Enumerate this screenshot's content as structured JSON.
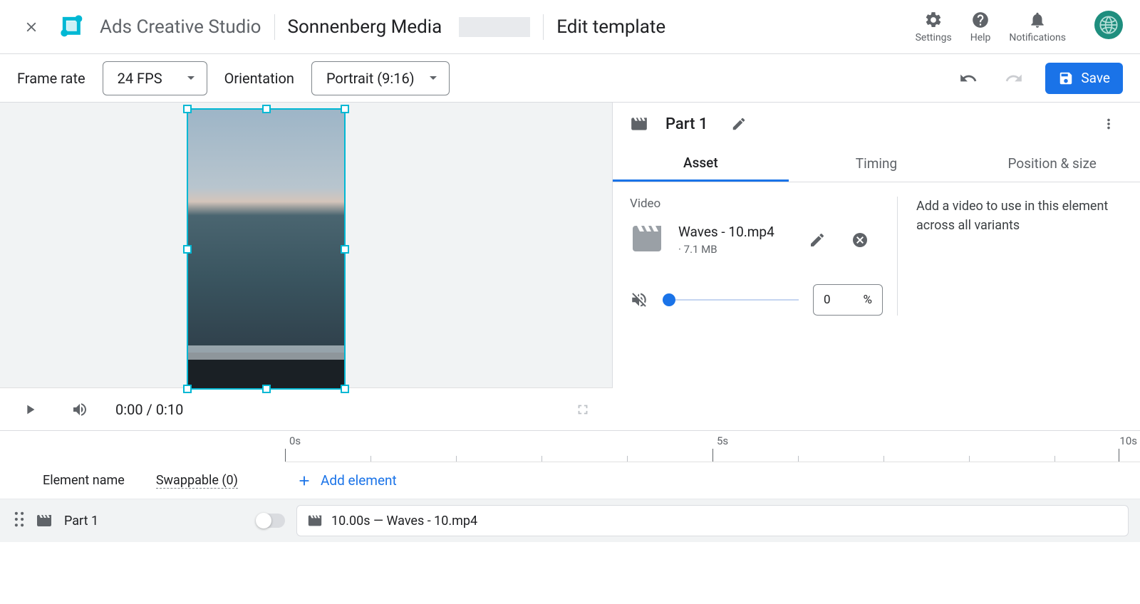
{
  "header": {
    "appTitle": "Ads Creative Studio",
    "workspace": "Sonnenberg Media",
    "breadcrumb": "Edit template",
    "icons": {
      "settings": "Settings",
      "help": "Help",
      "notifications": "Notifications"
    }
  },
  "toolbar": {
    "frameRateLabel": "Frame rate",
    "frameRateValue": "24 FPS",
    "orientationLabel": "Orientation",
    "orientationValue": "Portrait (9:16)",
    "saveLabel": "Save"
  },
  "playback": {
    "time": "0:00 / 0:10"
  },
  "sidepanel": {
    "partTitle": "Part 1",
    "tabs": {
      "asset": "Asset",
      "timing": "Timing",
      "position": "Position & size"
    },
    "asset": {
      "sectionTitle": "Video",
      "fileName": "Waves - 10.mp4",
      "fileSize": "· 7.1 MB",
      "volumeValue": "0",
      "volumeUnit": "%",
      "hint": "Add a video to use in this element across all variants"
    }
  },
  "timeline": {
    "ruler": {
      "t0": "0s",
      "t5": "5s",
      "t10": "10s"
    },
    "header": {
      "elementName": "Element name",
      "swappable": "Swappable (0)",
      "addElement": "Add element"
    },
    "track": {
      "name": "Part 1",
      "clip": "10.00s — Waves - 10.mp4"
    }
  }
}
